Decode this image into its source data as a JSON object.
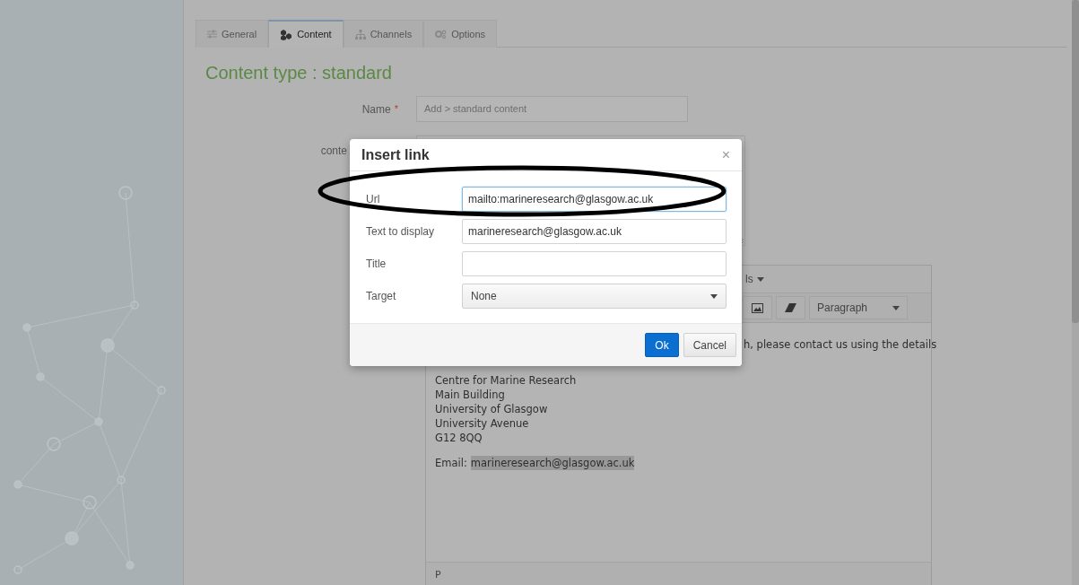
{
  "tabs": [
    {
      "label": "General",
      "selected": false
    },
    {
      "label": "Content",
      "selected": true
    },
    {
      "label": "Channels",
      "selected": false
    },
    {
      "label": "Options",
      "selected": false
    }
  ],
  "heading": "Content type : standard",
  "form": {
    "name_label": "Name",
    "required_mark": "*",
    "name_value": "Add > standard content",
    "content_label": "conte"
  },
  "editor": {
    "menu_item": "ls",
    "format_select": "Paragraph",
    "first_line": "h, please contact us using the details",
    "address": [
      "Centre for Marine Research",
      "Main Building",
      "University of Glasgow",
      "University Avenue",
      "G12 8QQ"
    ],
    "email_label": "Email:",
    "email_link": "marineresearch@glasgow.ac.uk",
    "email_selected": true,
    "status_path": "P"
  },
  "dialog": {
    "title": "Insert link",
    "close": "×",
    "fields": [
      {
        "label": "Url",
        "kind": "text",
        "value": "mailto:marineresearch@glasgow.ac.uk",
        "focused": true
      },
      {
        "label": "Text to display",
        "kind": "text",
        "value": "marineresearch@glasgow.ac.uk",
        "focused": false
      },
      {
        "label": "Title",
        "kind": "text",
        "focused": false
      },
      {
        "label": "Target",
        "kind": "select",
        "value": "None",
        "focused": false
      }
    ],
    "buttons": [
      {
        "label": "Ok",
        "primary": true
      },
      {
        "label": "Cancel",
        "primary": false
      }
    ]
  }
}
